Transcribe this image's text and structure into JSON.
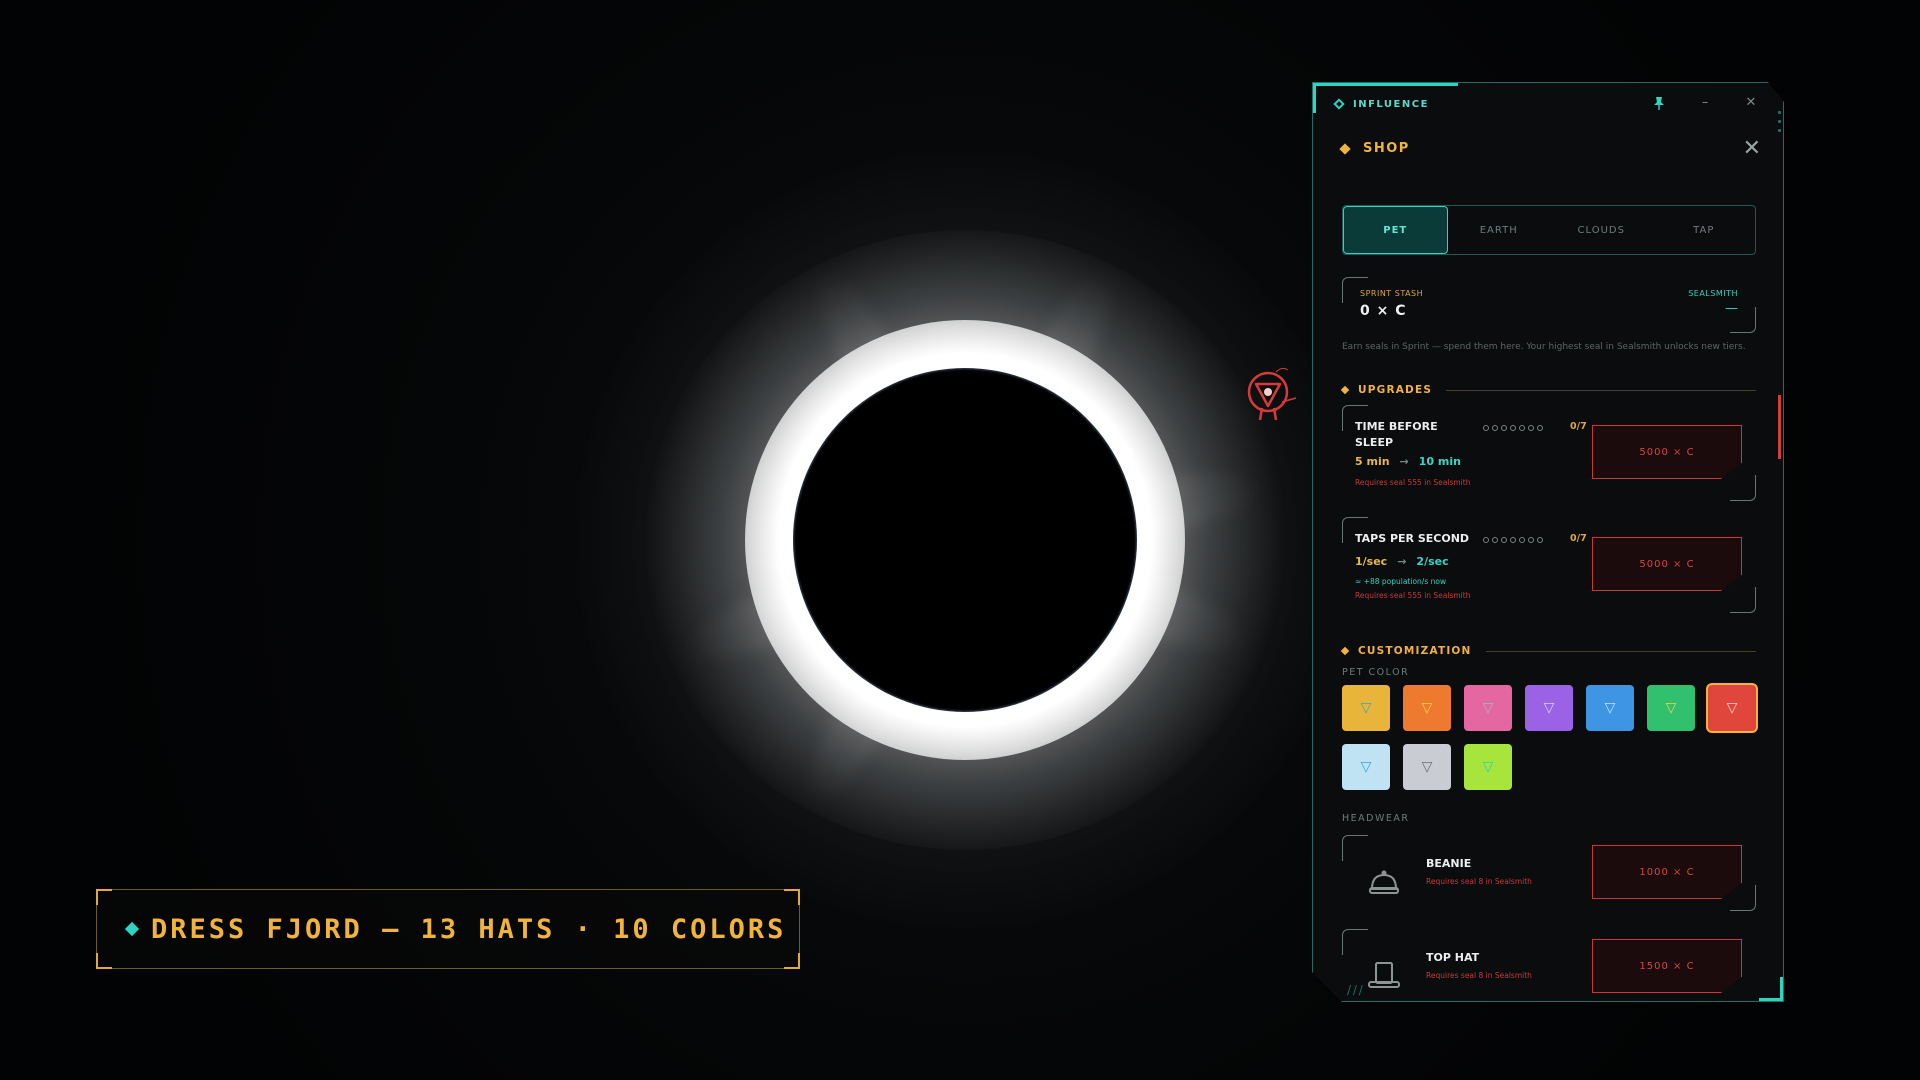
{
  "caption": {
    "text": "DRESS FJORD — 13 HATS · 10 COLORS"
  },
  "window": {
    "title": "INFLUENCE",
    "pin_icon": "pin-icon",
    "minimize": "–",
    "close": "✕"
  },
  "shop": {
    "title": "SHOP",
    "close": "✕",
    "tabs": [
      {
        "label": "PET",
        "active": true
      },
      {
        "label": "EARTH",
        "active": false
      },
      {
        "label": "CLOUDS",
        "active": false
      },
      {
        "label": "TAP",
        "active": false
      }
    ],
    "stash": {
      "label": "SPRINT STASH",
      "value": "0 × C",
      "right_label": "SEALSMITH",
      "right_value": "—"
    },
    "hint": "Earn seals in Sprint — spend them here. Your highest seal in Sealsmith unlocks new tiers.",
    "upgrades_title": "UPGRADES",
    "upgrades": [
      {
        "name": "TIME BEFORE SLEEP",
        "progress": "0/7",
        "level": 0,
        "max_level": 7,
        "from": "5 min",
        "to": "10 min",
        "note": "",
        "requirement": "Requires seal 555 in Sealsmith",
        "price": "5000 × C"
      },
      {
        "name": "TAPS PER SECOND",
        "progress": "0/7",
        "level": 0,
        "max_level": 7,
        "from": "1/sec",
        "to": "2/sec",
        "note": "≈ +88 population/s now",
        "requirement": "Requires seal 555 in Sealsmith",
        "price": "5000 × C"
      }
    ],
    "customization_title": "CUSTOMIZATION",
    "pet_color_label": "PET COLOR",
    "colors": [
      {
        "name": "yellow",
        "hex": "#e9b43a",
        "tri": "#3aa8c7",
        "selected": false
      },
      {
        "name": "orange",
        "hex": "#ee7a2f",
        "tri": "#f7d34a",
        "selected": false
      },
      {
        "name": "pink",
        "hex": "#e567a1",
        "tri": "#9fb6c9",
        "selected": false
      },
      {
        "name": "purple",
        "hex": "#9b62e6",
        "tri": "#d9d1f0",
        "selected": false
      },
      {
        "name": "blue",
        "hex": "#3d95e4",
        "tri": "#bfe3f5",
        "selected": false
      },
      {
        "name": "green",
        "hex": "#30c06e",
        "tri": "#f2d23a",
        "selected": false
      },
      {
        "name": "red",
        "hex": "#e1463c",
        "tri": "#f8d5d0",
        "selected": true
      },
      {
        "name": "ice",
        "hex": "#bfe3f3",
        "tri": "#3aa8c7",
        "selected": false
      },
      {
        "name": "silver",
        "hex": "#c9ccd2",
        "tri": "#6e7076",
        "selected": false
      },
      {
        "name": "lime",
        "hex": "#a7e53c",
        "tri": "#2dd4bf",
        "selected": false
      }
    ],
    "headwear_label": "HEADWEAR",
    "hats": [
      {
        "name": "BEANIE",
        "icon": "beanie-icon",
        "requirement": "Requires seal 8 in Sealsmith",
        "price": "1000 × C"
      },
      {
        "name": "TOP HAT",
        "icon": "top-hat-icon",
        "requirement": "Requires seal 8 in Sealsmith",
        "price": "1500 × C"
      }
    ]
  },
  "colors": {
    "accent_teal": "#2dd4bf",
    "accent_gold": "#f2b33d",
    "danger_red": "#d94444"
  }
}
